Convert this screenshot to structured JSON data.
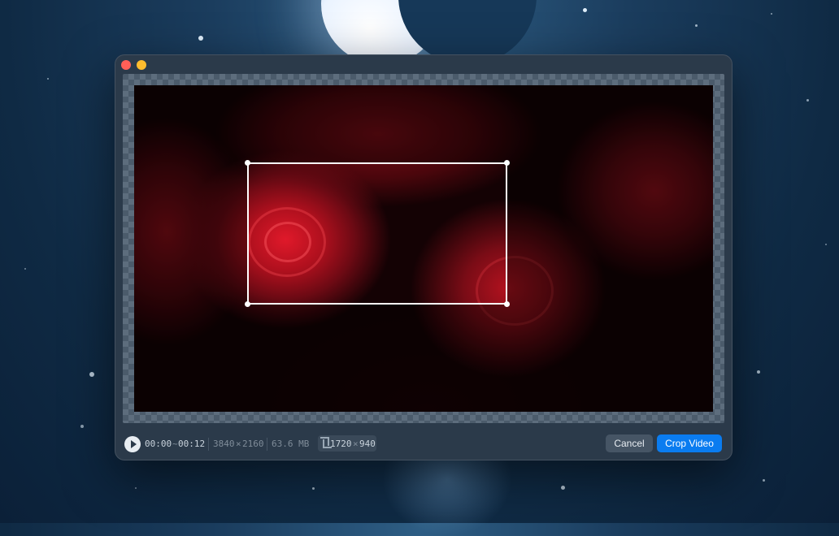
{
  "window": {
    "controls": [
      "close-button",
      "minimize-button"
    ]
  },
  "toolbar": {
    "time_start": "00:00",
    "time_separator": "~",
    "time_end": "00:12",
    "resolution_w": "3840",
    "resolution_sep": "×",
    "resolution_h": "2160",
    "file_size": "63.6 MB",
    "crop_w": "1720",
    "crop_sep": "×",
    "crop_h": "940",
    "cancel_label": "Cancel",
    "crop_label": "Crop Video"
  },
  "colors": {
    "accent": "#0a7cf0",
    "close": "#ff5f57",
    "minimize": "#febc2e"
  },
  "icons": {
    "play": "play-icon",
    "crop": "crop-icon"
  }
}
